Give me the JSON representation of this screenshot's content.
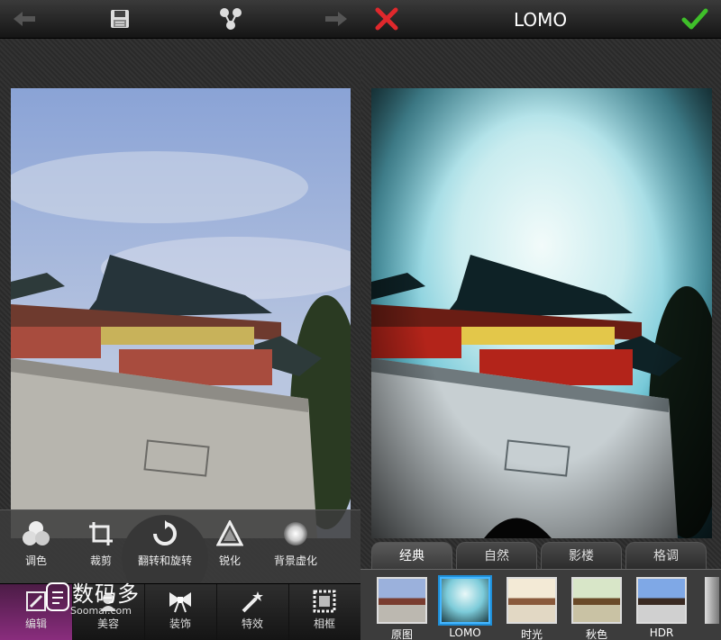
{
  "left": {
    "tools": [
      {
        "label": "调色",
        "icon": "color-circles-icon"
      },
      {
        "label": "裁剪",
        "icon": "crop-icon"
      },
      {
        "label": "翻转和旋转",
        "icon": "rotate-icon"
      },
      {
        "label": "锐化",
        "icon": "sharpen-triangle-icon"
      },
      {
        "label": "背景虚化",
        "icon": "blur-circle-icon"
      }
    ],
    "nav": [
      {
        "label": "编辑",
        "icon": "edit-icon",
        "active": true
      },
      {
        "label": "美容",
        "icon": "beauty-icon",
        "active": false
      },
      {
        "label": "装饰",
        "icon": "bow-icon",
        "active": false
      },
      {
        "label": "特效",
        "icon": "magic-wand-icon",
        "active": false
      },
      {
        "label": "相框",
        "icon": "frame-icon",
        "active": false
      }
    ],
    "watermark": {
      "title": "数码多",
      "sub": "Soomal.com"
    }
  },
  "right": {
    "title": "LOMO",
    "tabs": [
      {
        "label": "经典",
        "active": true
      },
      {
        "label": "自然",
        "active": false
      },
      {
        "label": "影楼",
        "active": false
      },
      {
        "label": "格调",
        "active": false
      }
    ],
    "filters": [
      {
        "label": "原图",
        "selected": false
      },
      {
        "label": "LOMO",
        "selected": true
      },
      {
        "label": "时光",
        "selected": false
      },
      {
        "label": "秋色",
        "selected": false
      },
      {
        "label": "HDR",
        "selected": false
      }
    ]
  },
  "colors": {
    "accent_green": "#3fbf2a",
    "accent_red": "#e0282c",
    "active_nav": "#8a2d7e",
    "selected_filter": "#45b6ff"
  }
}
